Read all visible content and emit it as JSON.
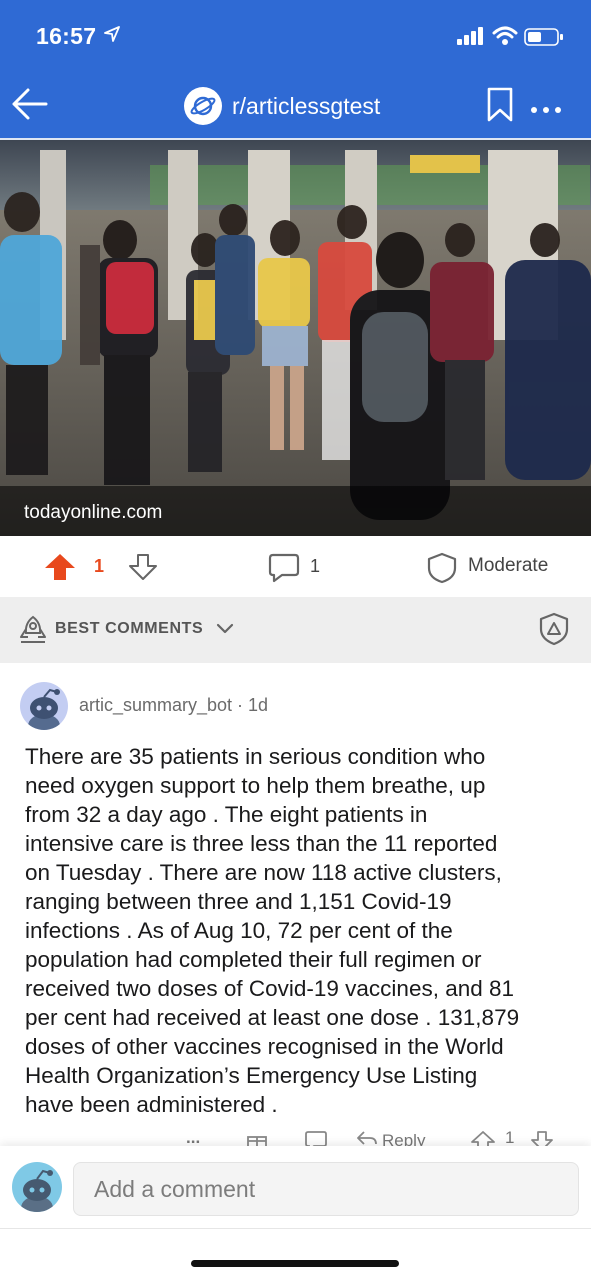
{
  "status_bar": {
    "time": "16:57"
  },
  "nav": {
    "subreddit": "r/articlessgtest"
  },
  "post": {
    "image_caption": "todayonline.com",
    "score": "1",
    "comment_count": "1",
    "moderate_label": "Moderate"
  },
  "sort": {
    "label": "BEST COMMENTS"
  },
  "comment": {
    "author_meta": "artic_summary_bot · 1d",
    "lines": [
      "There are 35 patients in serious condition who",
      "need oxygen support to help them breathe, up",
      "from 32 a day ago . The eight patients in",
      "intensive care is three less than the 11 reported",
      "on Tuesday . There are now 118 active clusters,",
      "ranging between three and 1,151 Covid-19",
      "infections .  As of Aug 10, 72 per cent of the",
      "population had completed their full regimen or",
      "received two doses of Covid-19 vaccines, and 81",
      "per cent had received at least one dose . 131,879",
      "doses of other vaccines recognised in the World",
      "Health Organization’s Emergency Use Listing",
      "have been administered ."
    ],
    "more_label": "...",
    "reply_label": "Reply",
    "score": "1"
  },
  "composer": {
    "placeholder": "Add a comment"
  },
  "colors": {
    "header_blue": "#2f6ad4",
    "upvote_orange": "#e8491d"
  }
}
